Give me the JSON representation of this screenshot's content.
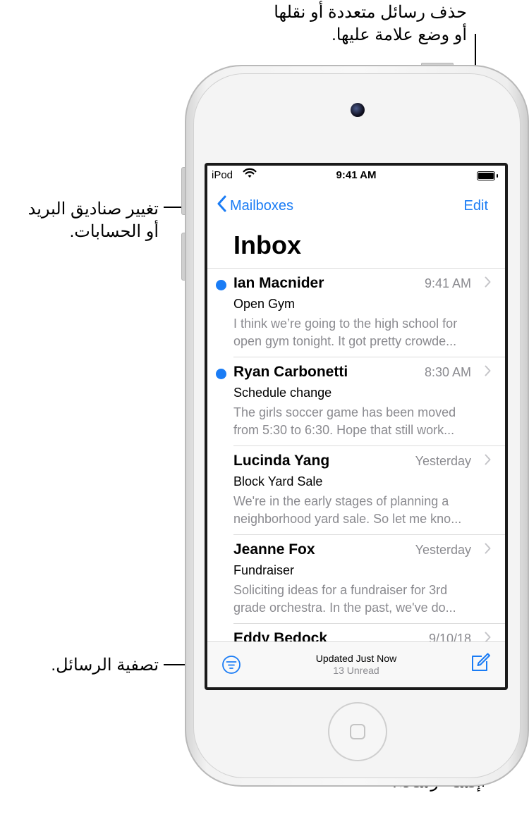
{
  "annotations": {
    "edit_callout_line1": "حذف رسائل متعددة أو نقلها",
    "edit_callout_line2": "أو وضع علامة عليها.",
    "mailboxes_callout_line1": "تغيير صناديق البريد",
    "mailboxes_callout_line2": "أو الحسابات.",
    "filter_callout": "تصفية الرسائل.",
    "compose_callout": "إنشاء رسالة."
  },
  "status_bar": {
    "carrier": "iPod",
    "time": "9:41 AM",
    "wifi_icon": "wifi-icon",
    "battery_icon": "battery-icon"
  },
  "nav": {
    "back_label": "Mailboxes",
    "back_icon": "chevron-left-icon",
    "edit_label": "Edit"
  },
  "page_title": "Inbox",
  "messages": [
    {
      "sender": "Ian Macnider",
      "date": "9:41 AM",
      "unread": true,
      "subject": "Open Gym",
      "preview_line1": "I think we’re going to the high school for",
      "preview_line2": "open gym tonight. It got pretty crowde..."
    },
    {
      "sender": "Ryan Carbonetti",
      "date": "8:30 AM",
      "unread": true,
      "subject": "Schedule change",
      "preview_line1": "The girls soccer game has been moved",
      "preview_line2": "from 5:30 to 6:30. Hope that still work..."
    },
    {
      "sender": "Lucinda Yang",
      "date": "Yesterday",
      "unread": false,
      "subject": "Block Yard Sale",
      "preview_line1": "We're in the early stages of planning a",
      "preview_line2": "neighborhood yard sale. So let me kno..."
    },
    {
      "sender": "Jeanne Fox",
      "date": "Yesterday",
      "unread": false,
      "subject": "Fundraiser",
      "preview_line1": "Soliciting ideas for a fundraiser for 3rd",
      "preview_line2": "grade orchestra. In the past, we've do..."
    },
    {
      "sender": "Eddy Bedock",
      "date": "9/10/18",
      "unread": false,
      "subject": "",
      "preview_line1": "",
      "preview_line2": ""
    }
  ],
  "toolbar": {
    "status": "Updated Just Now",
    "unread_count": "13 Unread",
    "filter_icon": "filter-icon",
    "compose_icon": "compose-icon"
  },
  "colors": {
    "accent": "#1a7cf5",
    "secondary_text": "#8a8a8f"
  }
}
